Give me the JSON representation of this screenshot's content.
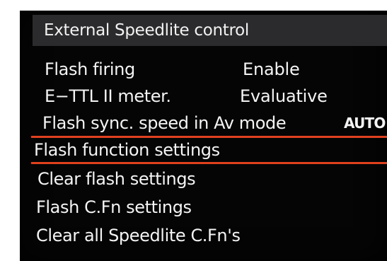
{
  "menu": {
    "title": "External Speedlite control",
    "items": [
      {
        "label": "Flash firing",
        "value": "Enable"
      },
      {
        "label": "E−TTL II meter.",
        "value": "Evaluative"
      },
      {
        "label": "Flash sync. speed in Av mode",
        "value": "AUTO"
      },
      {
        "label": "Flash function settings",
        "value": ""
      },
      {
        "label": "Clear flash settings",
        "value": ""
      },
      {
        "label": "Flash C.Fn settings",
        "value": ""
      },
      {
        "label": "Clear all Speedlite C.Fn's",
        "value": ""
      }
    ],
    "selected_index": 3
  },
  "colors": {
    "background": "#050505",
    "title_bar": "#2b2b2d",
    "text": "#f4f4f4",
    "selection": "#e0401e"
  }
}
